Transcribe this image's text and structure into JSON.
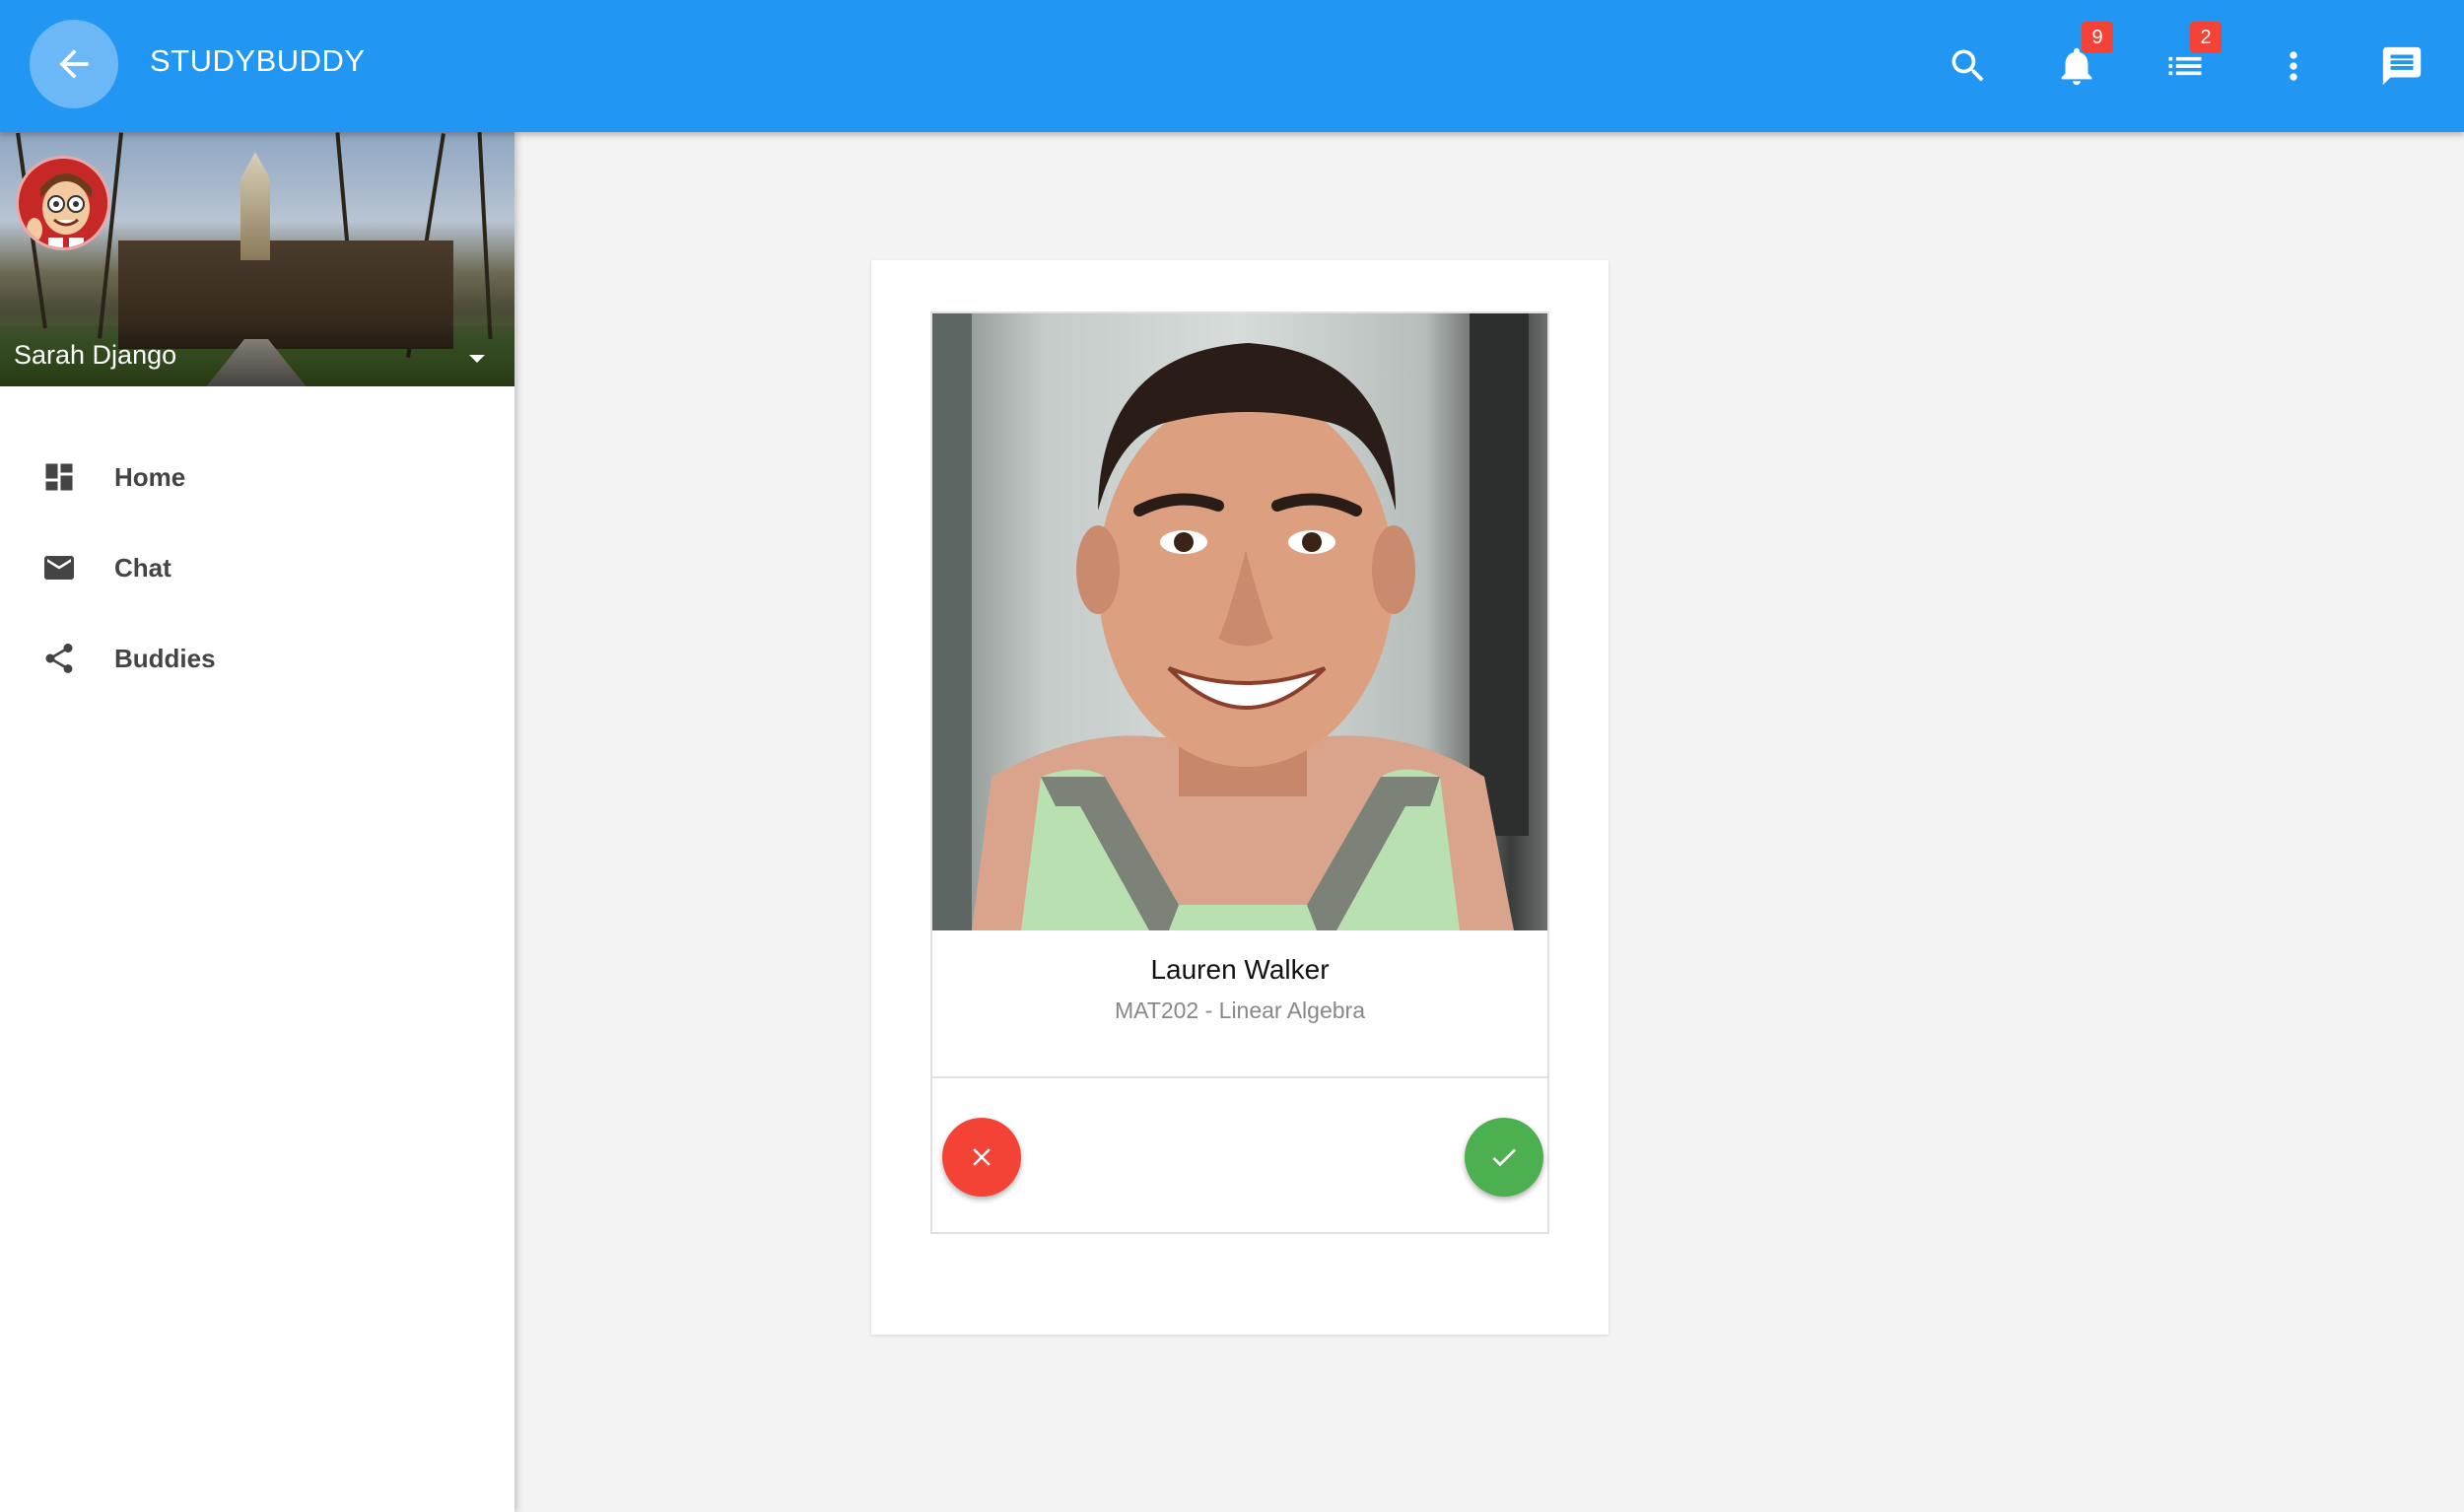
{
  "appbar": {
    "title": "STUDYBUDDY",
    "back_icon": "arrow-left-icon",
    "color": "#2196f3",
    "actions": [
      {
        "name": "search",
        "icon": "search-icon"
      },
      {
        "name": "notifications",
        "icon": "bell-icon",
        "badge": "9"
      },
      {
        "name": "list",
        "icon": "list-icon",
        "badge": "2"
      },
      {
        "name": "more",
        "icon": "more-vert-icon"
      },
      {
        "name": "messages",
        "icon": "message-icon"
      }
    ]
  },
  "sidebar": {
    "profile": {
      "name": "Sarah Django"
    },
    "items": [
      {
        "label": "Home",
        "icon": "dashboard-icon"
      },
      {
        "label": "Chat",
        "icon": "mail-icon"
      },
      {
        "label": "Buddies",
        "icon": "share-icon"
      }
    ]
  },
  "card": {
    "name": "Lauren Walker",
    "course": "MAT202 - Linear Algebra",
    "reject_color": "#f44336",
    "accept_color": "#4caf50"
  }
}
